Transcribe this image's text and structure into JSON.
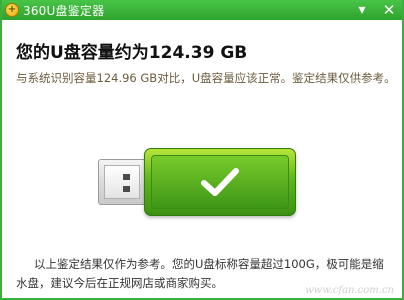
{
  "window": {
    "title": "360U盘鉴定器",
    "logo_glyph": "+",
    "accent_color": "#3cae3c"
  },
  "titlebar_buttons": {
    "menu_icon": "dropdown-arrow-icon",
    "menu_glyph": "▾",
    "close_icon": "close-icon",
    "close_glyph": "✕"
  },
  "result": {
    "heading": "您的U盘容量约为124.39 GB",
    "detail": "与系统识别容量124.96 GB对比，U盘容量应该正常。鉴定结果仅供参考。",
    "note": "以上鉴定结果仅作为参考。您的U盘标称容量超过100G，极可能是缩水盘，建议今后在正规网店或商家购买。",
    "status_icon": "check-icon",
    "status_color": "#ffffff"
  },
  "watermark": "www.cfan.com.cn"
}
